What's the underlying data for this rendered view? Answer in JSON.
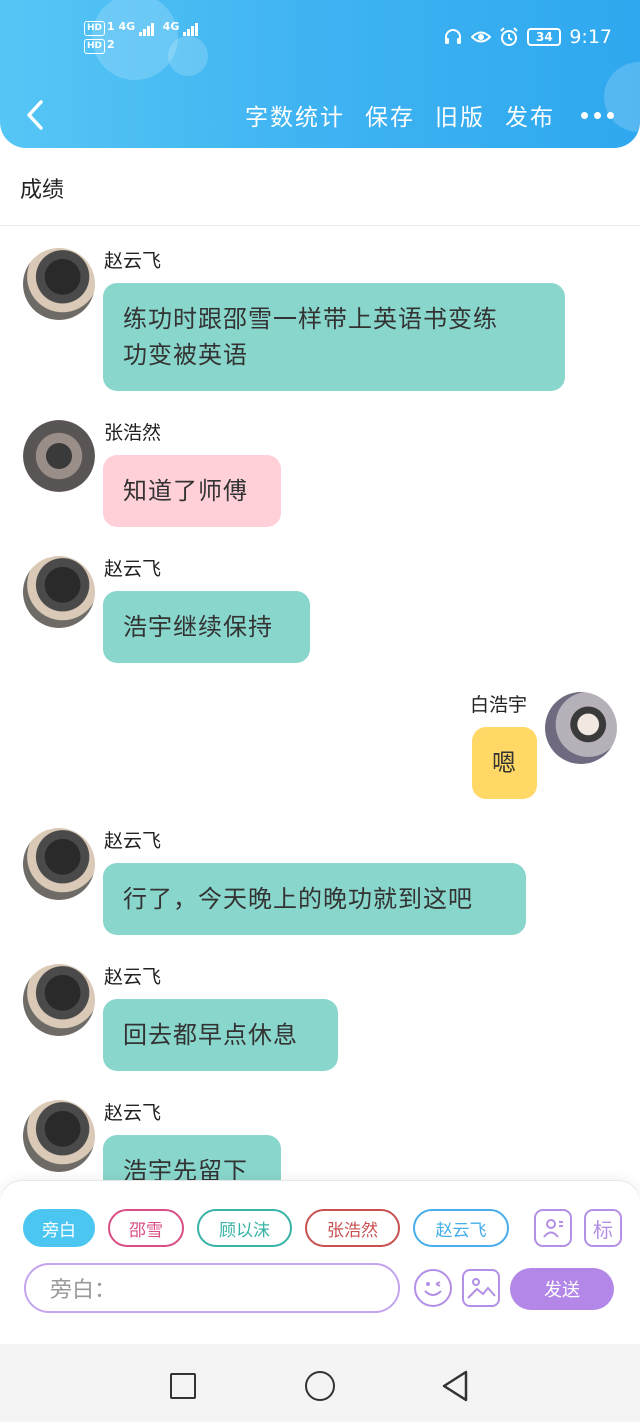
{
  "status_bar": {
    "network_left": "HD1 4G / HD2 4G",
    "battery": "34",
    "time": "9:17",
    "icons": [
      "headphones-icon",
      "eye-icon",
      "alarm-icon",
      "battery-icon"
    ]
  },
  "header": {
    "back_icon": "chevron-left-icon",
    "actions": [
      "字数统计",
      "保存",
      "旧版",
      "发布"
    ],
    "more_icon": "more-dots-icon"
  },
  "title": "成绩",
  "messages": [
    {
      "speaker": "赵云飞",
      "text_line1": "练功时跟邵雪一样带上英语书变练",
      "text_line2": "功变被英语",
      "side": "left",
      "color": "#89d7cc"
    },
    {
      "speaker": "张浩然",
      "text_line1": "知道了师傅",
      "side": "left",
      "color": "#ffd0d8"
    },
    {
      "speaker": "赵云飞",
      "text_line1": "浩宇继续保持",
      "side": "left",
      "color": "#89d7cc"
    },
    {
      "speaker": "白浩宇",
      "text_line1": "嗯",
      "side": "right",
      "color": "#ffd865"
    },
    {
      "speaker": "赵云飞",
      "text_line1": "行了，今天晚上的晚功就到这吧",
      "side": "left",
      "color": "#89d7cc"
    },
    {
      "speaker": "赵云飞",
      "text_line1": "回去都早点休息",
      "side": "left",
      "color": "#89d7cc"
    },
    {
      "speaker": "赵云飞",
      "text_line1": "浩宇先留下",
      "side": "left",
      "color": "#89d7cc"
    }
  ],
  "composer": {
    "roles": [
      "旁白",
      "邵雪",
      "顾以沫",
      "张浩然",
      "赵云飞"
    ],
    "selected_role": "旁白",
    "person_icon": "person-card-icon",
    "tag_icon_label": "标",
    "input_placeholder": "旁白：",
    "emoji_icon": "smiley-icon",
    "image_icon": "image-icon",
    "send_label": "发送"
  },
  "system_nav": [
    "recent-apps-icon",
    "home-icon",
    "back-triangle-icon"
  ]
}
